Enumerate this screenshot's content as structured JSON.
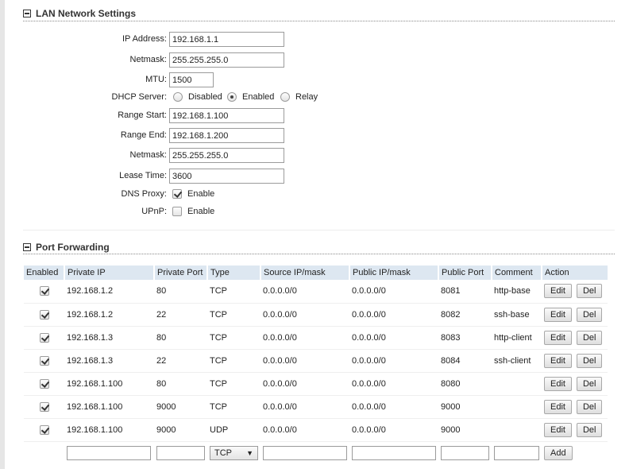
{
  "lan": {
    "title": "LAN Network Settings",
    "ip_label": "IP Address:",
    "ip_value": "192.168.1.1",
    "netmask_label": "Netmask:",
    "netmask_value": "255.255.255.0",
    "mtu_label": "MTU:",
    "mtu_value": "1500",
    "dhcp_label": "DHCP Server:",
    "dhcp_options": [
      "Disabled",
      "Enabled",
      "Relay"
    ],
    "dhcp_selected": "Enabled",
    "range_start_label": "Range Start:",
    "range_start_value": "192.168.1.100",
    "range_end_label": "Range End:",
    "range_end_value": "192.168.1.200",
    "dhcp_netmask_label": "Netmask:",
    "dhcp_netmask_value": "255.255.255.0",
    "lease_label": "Lease Time:",
    "lease_value": "3600",
    "dns_proxy_label": "DNS Proxy:",
    "dns_proxy_option": "Enable",
    "dns_proxy_checked": true,
    "upnp_label": "UPnP:",
    "upnp_option": "Enable",
    "upnp_checked": false
  },
  "port_forwarding": {
    "title": "Port Forwarding",
    "headers": [
      "Enabled",
      "Private IP",
      "Private Port",
      "Type",
      "Source IP/mask",
      "Public IP/mask",
      "Public Port",
      "Comment",
      "Action"
    ],
    "rows": [
      {
        "enabled": true,
        "private_ip": "192.168.1.2",
        "private_port": "80",
        "type": "TCP",
        "source": "0.0.0.0/0",
        "public_ip": "0.0.0.0/0",
        "public_port": "8081",
        "comment": "http-base"
      },
      {
        "enabled": true,
        "private_ip": "192.168.1.2",
        "private_port": "22",
        "type": "TCP",
        "source": "0.0.0.0/0",
        "public_ip": "0.0.0.0/0",
        "public_port": "8082",
        "comment": "ssh-base"
      },
      {
        "enabled": true,
        "private_ip": "192.168.1.3",
        "private_port": "80",
        "type": "TCP",
        "source": "0.0.0.0/0",
        "public_ip": "0.0.0.0/0",
        "public_port": "8083",
        "comment": "http-client"
      },
      {
        "enabled": true,
        "private_ip": "192.168.1.3",
        "private_port": "22",
        "type": "TCP",
        "source": "0.0.0.0/0",
        "public_ip": "0.0.0.0/0",
        "public_port": "8084",
        "comment": "ssh-client"
      },
      {
        "enabled": true,
        "private_ip": "192.168.1.100",
        "private_port": "80",
        "type": "TCP",
        "source": "0.0.0.0/0",
        "public_ip": "0.0.0.0/0",
        "public_port": "8080",
        "comment": ""
      },
      {
        "enabled": true,
        "private_ip": "192.168.1.100",
        "private_port": "9000",
        "type": "TCP",
        "source": "0.0.0.0/0",
        "public_ip": "0.0.0.0/0",
        "public_port": "9000",
        "comment": ""
      },
      {
        "enabled": true,
        "private_ip": "192.168.1.100",
        "private_port": "9000",
        "type": "UDP",
        "source": "0.0.0.0/0",
        "public_ip": "0.0.0.0/0",
        "public_port": "9000",
        "comment": ""
      }
    ],
    "edit_label": "Edit",
    "del_label": "Del",
    "new_type_value": "TCP",
    "add_label": "Add"
  }
}
